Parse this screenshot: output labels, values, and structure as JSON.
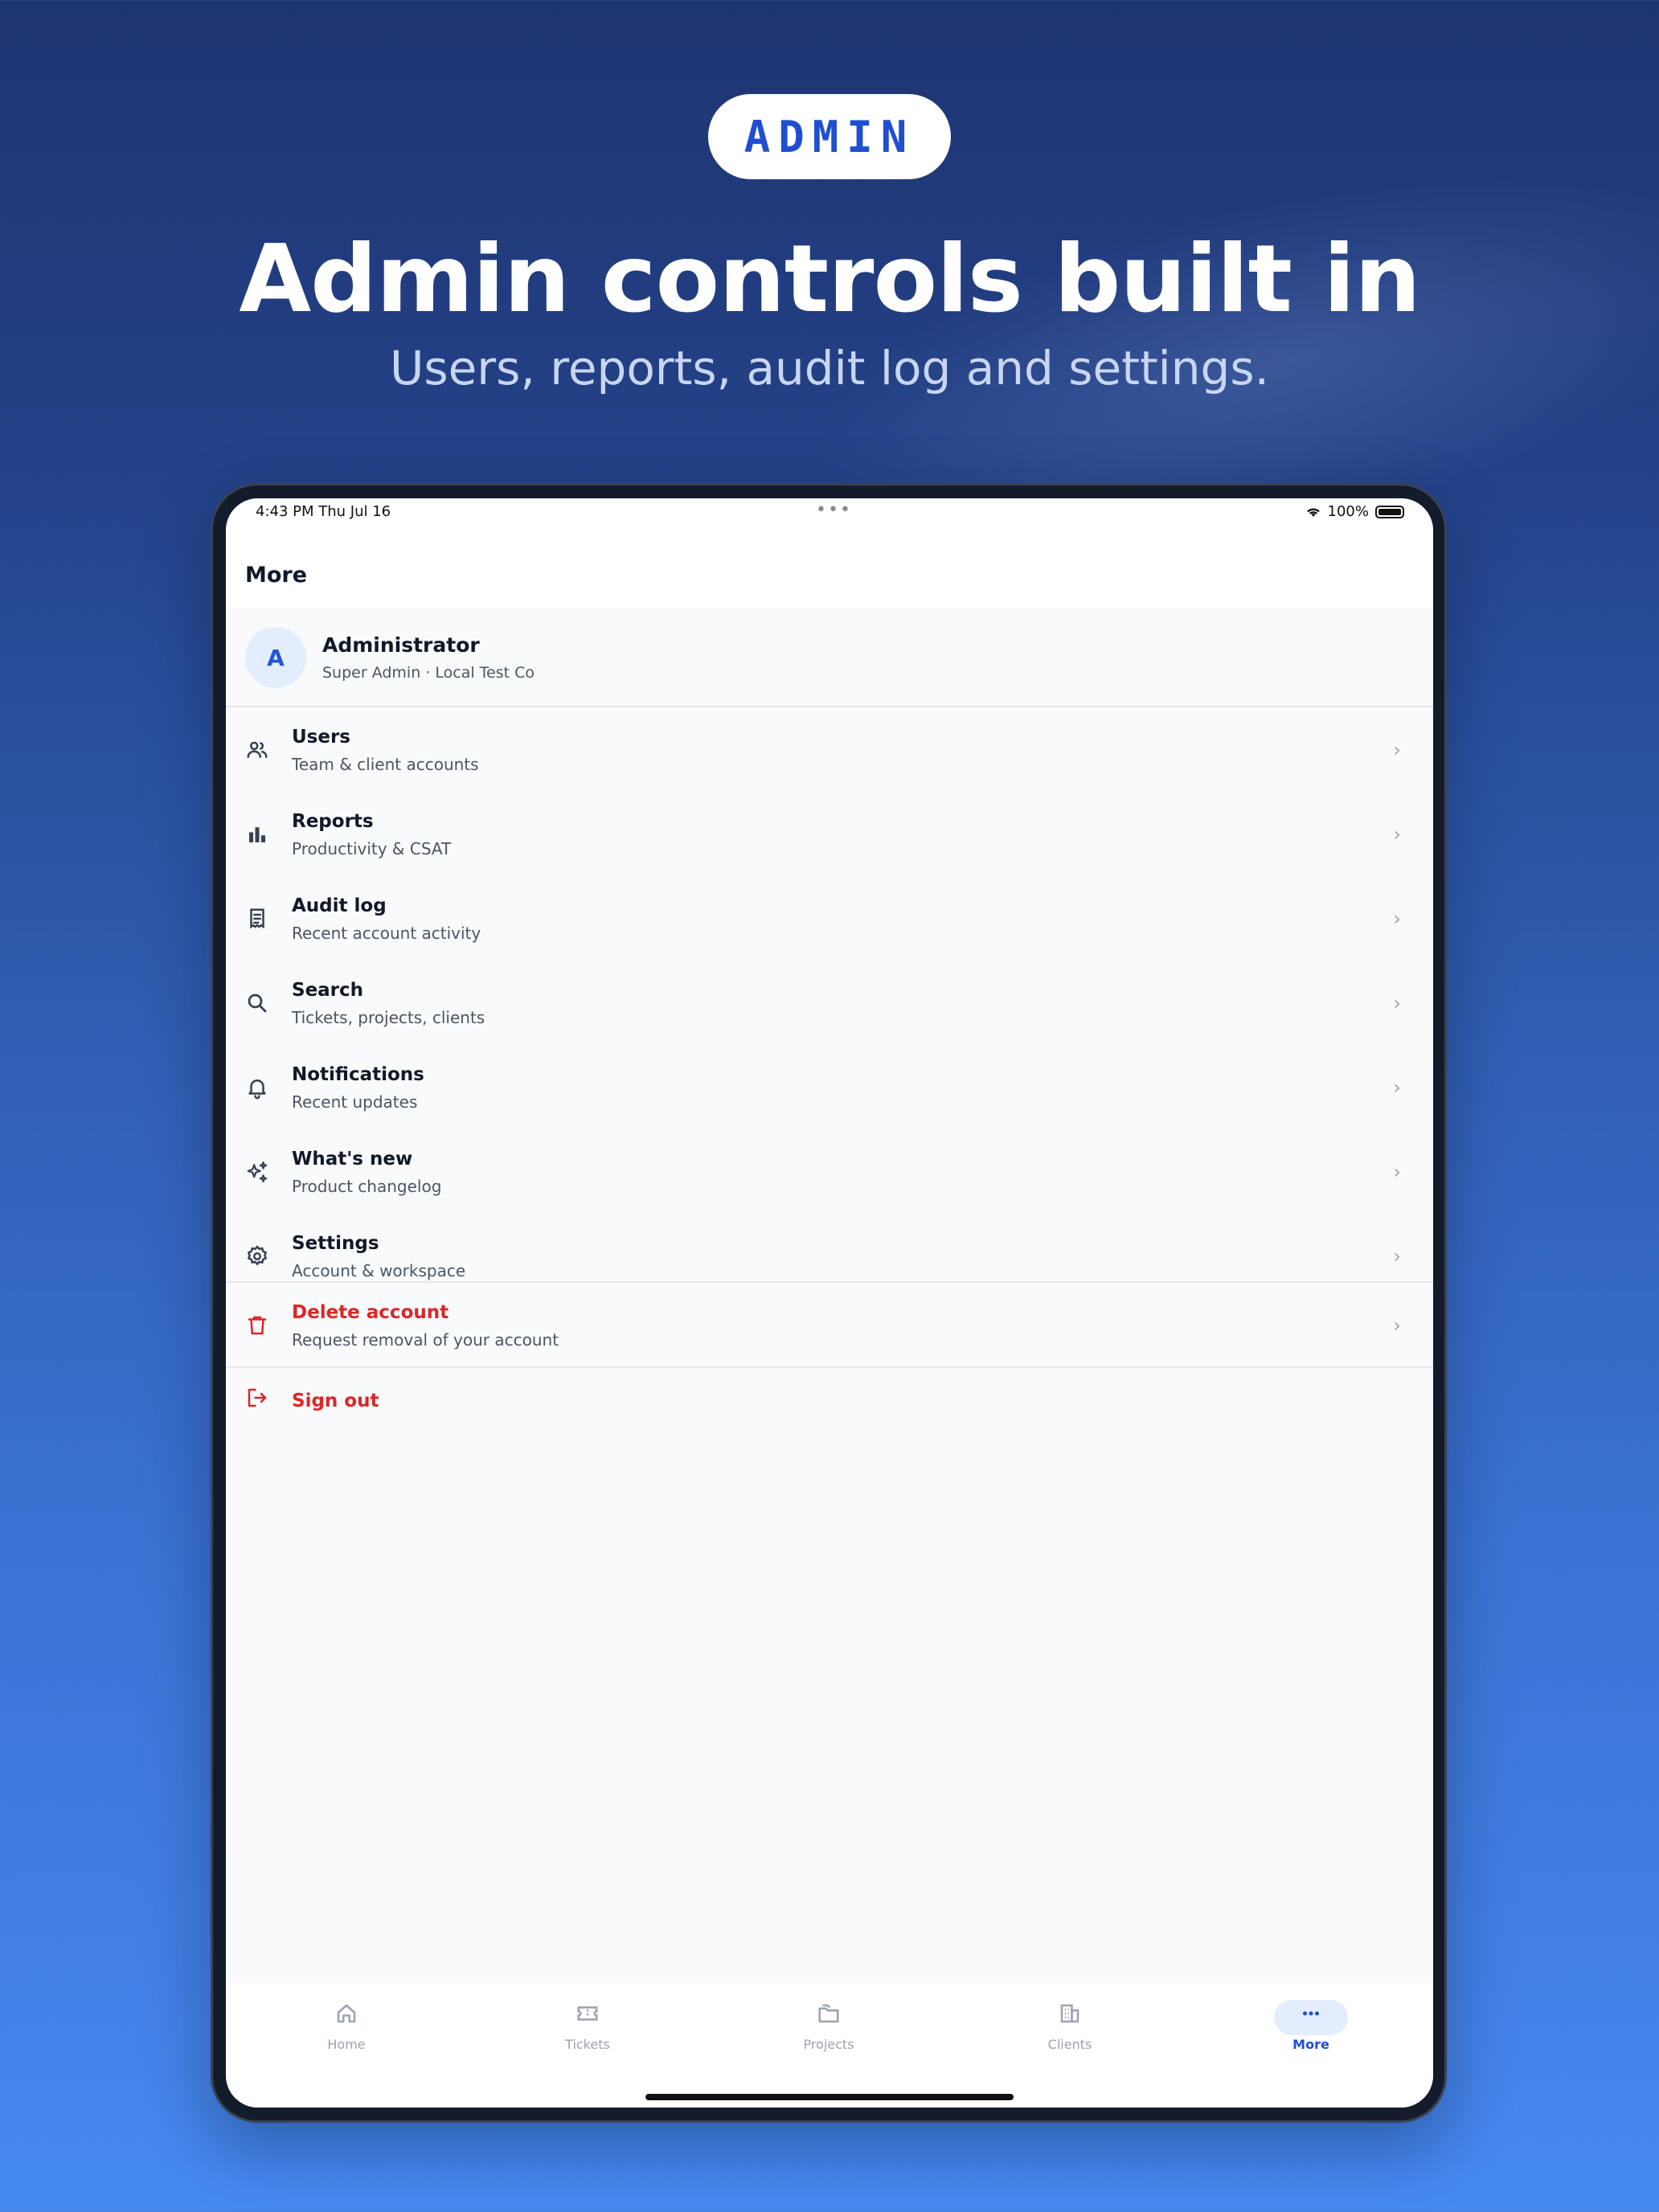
{
  "badge": "ADMIN",
  "headline": "Admin controls built in",
  "subheadline": "Users, reports, audit log and settings.",
  "status_bar": {
    "time": "4:43 PM   Thu Jul 16",
    "dots": "•••",
    "battery": "100%"
  },
  "header": {
    "title": "More"
  },
  "profile": {
    "initial": "A",
    "name": "Administrator",
    "role": "Super Admin · Local Test Co"
  },
  "menu": [
    {
      "icon": "users-icon",
      "title": "Users",
      "subtitle": "Team & client accounts"
    },
    {
      "icon": "bar-chart-icon",
      "title": "Reports",
      "subtitle": "Productivity & CSAT"
    },
    {
      "icon": "receipt-icon",
      "title": "Audit log",
      "subtitle": "Recent account activity"
    },
    {
      "icon": "search-icon",
      "title": "Search",
      "subtitle": "Tickets, projects, clients"
    },
    {
      "icon": "bell-icon",
      "title": "Notifications",
      "subtitle": "Recent updates"
    },
    {
      "icon": "sparkles-icon",
      "title": "What's new",
      "subtitle": "Product changelog"
    },
    {
      "icon": "gear-icon",
      "title": "Settings",
      "subtitle": "Account & workspace"
    }
  ],
  "delete_account": {
    "icon": "trash-icon",
    "title": "Delete account",
    "subtitle": "Request removal of your account"
  },
  "sign_out": {
    "icon": "sign-out-icon",
    "title": "Sign out"
  },
  "tabs": [
    {
      "icon": "home-icon",
      "label": "Home"
    },
    {
      "icon": "ticket-icon",
      "label": "Tickets"
    },
    {
      "icon": "folder-icon",
      "label": "Projects"
    },
    {
      "icon": "building-icon",
      "label": "Clients"
    },
    {
      "icon": "more-icon",
      "label": "More",
      "active": true
    }
  ],
  "colors": {
    "accent": "#1f4fd0",
    "danger": "#dc2626",
    "background_top": "#1e3470",
    "background_bottom": "#4689f0"
  }
}
